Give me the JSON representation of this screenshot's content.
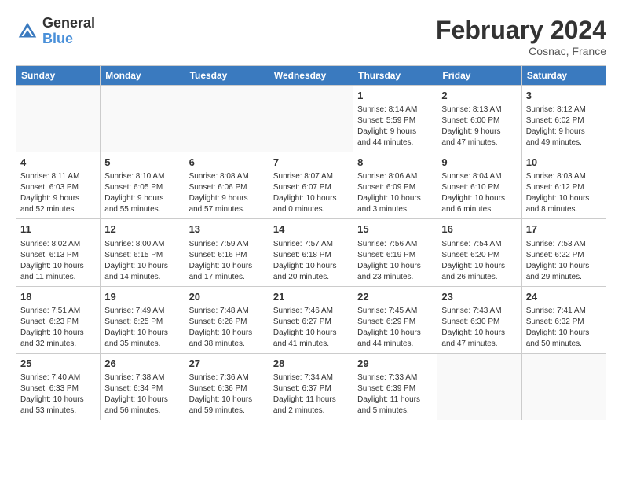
{
  "header": {
    "logo_text_general": "General",
    "logo_text_blue": "Blue",
    "month_title": "February 2024",
    "location": "Cosnac, France"
  },
  "weekdays": [
    "Sunday",
    "Monday",
    "Tuesday",
    "Wednesday",
    "Thursday",
    "Friday",
    "Saturday"
  ],
  "weeks": [
    [
      {
        "day": "",
        "info": ""
      },
      {
        "day": "",
        "info": ""
      },
      {
        "day": "",
        "info": ""
      },
      {
        "day": "",
        "info": ""
      },
      {
        "day": "1",
        "info": "Sunrise: 8:14 AM\nSunset: 5:59 PM\nDaylight: 9 hours\nand 44 minutes."
      },
      {
        "day": "2",
        "info": "Sunrise: 8:13 AM\nSunset: 6:00 PM\nDaylight: 9 hours\nand 47 minutes."
      },
      {
        "day": "3",
        "info": "Sunrise: 8:12 AM\nSunset: 6:02 PM\nDaylight: 9 hours\nand 49 minutes."
      }
    ],
    [
      {
        "day": "4",
        "info": "Sunrise: 8:11 AM\nSunset: 6:03 PM\nDaylight: 9 hours\nand 52 minutes."
      },
      {
        "day": "5",
        "info": "Sunrise: 8:10 AM\nSunset: 6:05 PM\nDaylight: 9 hours\nand 55 minutes."
      },
      {
        "day": "6",
        "info": "Sunrise: 8:08 AM\nSunset: 6:06 PM\nDaylight: 9 hours\nand 57 minutes."
      },
      {
        "day": "7",
        "info": "Sunrise: 8:07 AM\nSunset: 6:07 PM\nDaylight: 10 hours\nand 0 minutes."
      },
      {
        "day": "8",
        "info": "Sunrise: 8:06 AM\nSunset: 6:09 PM\nDaylight: 10 hours\nand 3 minutes."
      },
      {
        "day": "9",
        "info": "Sunrise: 8:04 AM\nSunset: 6:10 PM\nDaylight: 10 hours\nand 6 minutes."
      },
      {
        "day": "10",
        "info": "Sunrise: 8:03 AM\nSunset: 6:12 PM\nDaylight: 10 hours\nand 8 minutes."
      }
    ],
    [
      {
        "day": "11",
        "info": "Sunrise: 8:02 AM\nSunset: 6:13 PM\nDaylight: 10 hours\nand 11 minutes."
      },
      {
        "day": "12",
        "info": "Sunrise: 8:00 AM\nSunset: 6:15 PM\nDaylight: 10 hours\nand 14 minutes."
      },
      {
        "day": "13",
        "info": "Sunrise: 7:59 AM\nSunset: 6:16 PM\nDaylight: 10 hours\nand 17 minutes."
      },
      {
        "day": "14",
        "info": "Sunrise: 7:57 AM\nSunset: 6:18 PM\nDaylight: 10 hours\nand 20 minutes."
      },
      {
        "day": "15",
        "info": "Sunrise: 7:56 AM\nSunset: 6:19 PM\nDaylight: 10 hours\nand 23 minutes."
      },
      {
        "day": "16",
        "info": "Sunrise: 7:54 AM\nSunset: 6:20 PM\nDaylight: 10 hours\nand 26 minutes."
      },
      {
        "day": "17",
        "info": "Sunrise: 7:53 AM\nSunset: 6:22 PM\nDaylight: 10 hours\nand 29 minutes."
      }
    ],
    [
      {
        "day": "18",
        "info": "Sunrise: 7:51 AM\nSunset: 6:23 PM\nDaylight: 10 hours\nand 32 minutes."
      },
      {
        "day": "19",
        "info": "Sunrise: 7:49 AM\nSunset: 6:25 PM\nDaylight: 10 hours\nand 35 minutes."
      },
      {
        "day": "20",
        "info": "Sunrise: 7:48 AM\nSunset: 6:26 PM\nDaylight: 10 hours\nand 38 minutes."
      },
      {
        "day": "21",
        "info": "Sunrise: 7:46 AM\nSunset: 6:27 PM\nDaylight: 10 hours\nand 41 minutes."
      },
      {
        "day": "22",
        "info": "Sunrise: 7:45 AM\nSunset: 6:29 PM\nDaylight: 10 hours\nand 44 minutes."
      },
      {
        "day": "23",
        "info": "Sunrise: 7:43 AM\nSunset: 6:30 PM\nDaylight: 10 hours\nand 47 minutes."
      },
      {
        "day": "24",
        "info": "Sunrise: 7:41 AM\nSunset: 6:32 PM\nDaylight: 10 hours\nand 50 minutes."
      }
    ],
    [
      {
        "day": "25",
        "info": "Sunrise: 7:40 AM\nSunset: 6:33 PM\nDaylight: 10 hours\nand 53 minutes."
      },
      {
        "day": "26",
        "info": "Sunrise: 7:38 AM\nSunset: 6:34 PM\nDaylight: 10 hours\nand 56 minutes."
      },
      {
        "day": "27",
        "info": "Sunrise: 7:36 AM\nSunset: 6:36 PM\nDaylight: 10 hours\nand 59 minutes."
      },
      {
        "day": "28",
        "info": "Sunrise: 7:34 AM\nSunset: 6:37 PM\nDaylight: 11 hours\nand 2 minutes."
      },
      {
        "day": "29",
        "info": "Sunrise: 7:33 AM\nSunset: 6:39 PM\nDaylight: 11 hours\nand 5 minutes."
      },
      {
        "day": "",
        "info": ""
      },
      {
        "day": "",
        "info": ""
      }
    ]
  ]
}
